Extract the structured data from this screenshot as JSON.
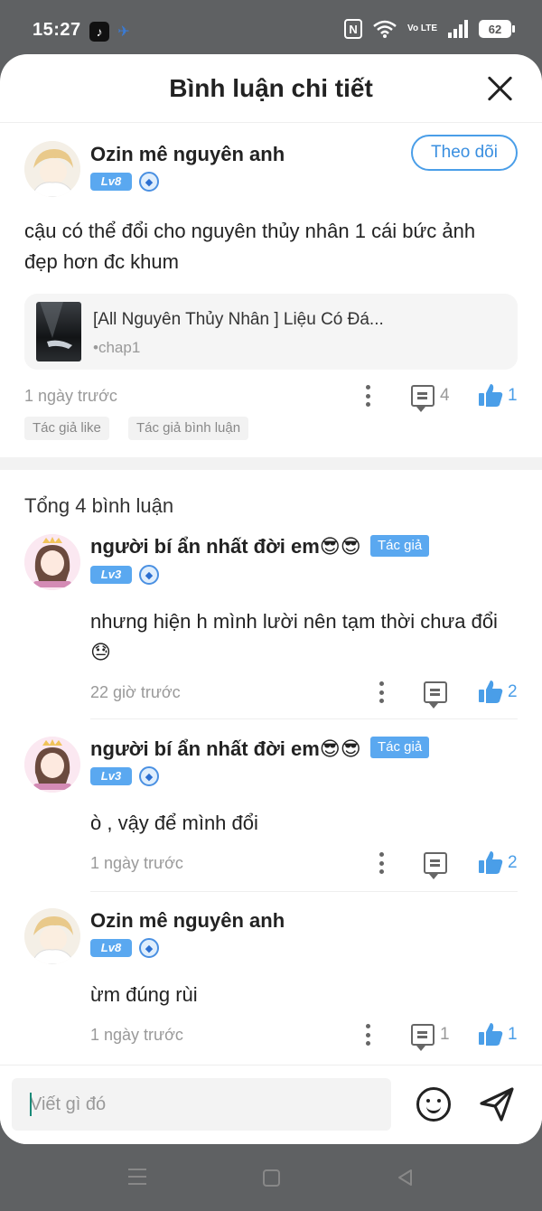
{
  "status_bar": {
    "time": "15:27",
    "battery": "62",
    "network": "Vo LTE",
    "icons": [
      "tiktok-icon",
      "bird-icon",
      "nfc-icon",
      "wifi-icon",
      "signal-icon",
      "battery-icon"
    ]
  },
  "header": {
    "title": "Bình luận chi tiết",
    "close_icon": "close-icon"
  },
  "main_comment": {
    "username": "Ozin mê nguyên anh",
    "level": "Lv8",
    "follow_label": "Theo dõi",
    "text": "cậu có thể đổi cho nguyên thủy nhân 1 cái bức ảnh đẹp hơn đc khum",
    "novel": {
      "title": "[All Nguyên Thủy Nhân ] Liệu Có Đá...",
      "chapter": "•chap1"
    },
    "time": "1 ngày trước",
    "reply_count": "4",
    "like_count": "1",
    "tags": [
      "Tác giả like",
      "Tác giả bình luận"
    ]
  },
  "total_comments": "Tổng 4 bình luận",
  "replies": [
    {
      "username": "người bí ẩn nhất đời em😎😎",
      "author_tag": "Tác giả",
      "level": "Lv3",
      "text": "nhưng hiện h mình lười nên tạm thời chưa đổi 😓",
      "time": "22 giờ trước",
      "reply_count": "",
      "like_count": "2"
    },
    {
      "username": "người bí ẩn nhất đời em😎😎",
      "author_tag": "Tác giả",
      "level": "Lv3",
      "text": "ò , vậy để mình đổi",
      "time": "1 ngày trước",
      "reply_count": "",
      "like_count": "2"
    },
    {
      "username": "Ozin mê nguyên anh",
      "author_tag": "",
      "level": "Lv8",
      "text": "ừm đúng rùi",
      "time": "1 ngày trước",
      "reply_count": "1",
      "like_count": "1"
    }
  ],
  "input": {
    "placeholder": "Viết gì đó"
  },
  "colors": {
    "accent": "#4a9ee8",
    "level_badge": "#5aa8f0",
    "muted_text": "#999999",
    "backdrop": "#5f6163"
  }
}
